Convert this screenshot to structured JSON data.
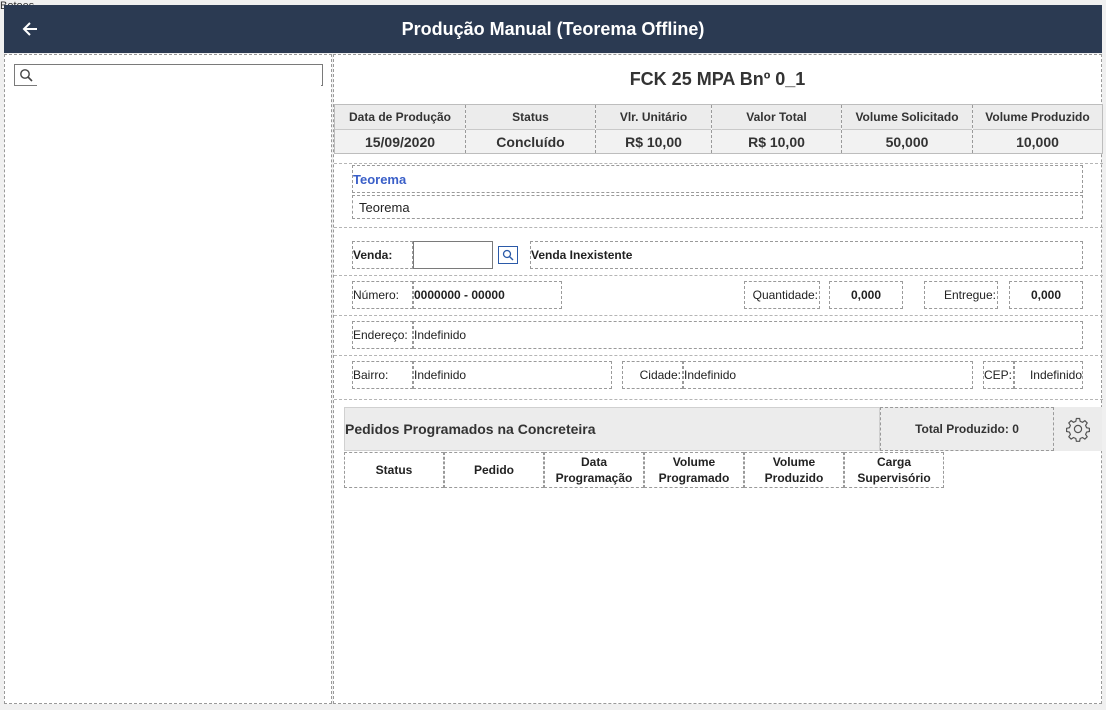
{
  "frame_label": "Botoes",
  "header": {
    "title": "Produção Manual (Teorema Offline)",
    "back_icon": "arrow-left-icon"
  },
  "sidebar": {
    "search": {
      "value": "",
      "placeholder": ""
    }
  },
  "main": {
    "product_title": "FCK 25 MPA Bnº 0_1",
    "summary": {
      "columns": [
        {
          "header": "Data de Produção",
          "value": "15/09/2020"
        },
        {
          "header": "Status",
          "value": "Concluído"
        },
        {
          "header": "Vlr. Unitário",
          "value": "R$ 10,00"
        },
        {
          "header": "Valor Total",
          "value": "R$ 10,00"
        },
        {
          "header": "Volume Solicitado",
          "value": "50,000"
        },
        {
          "header": "Volume Produzido",
          "value": "10,000"
        }
      ]
    },
    "section_title": "Teorema",
    "section_value": "Teorema",
    "venda": {
      "label": "Venda:",
      "value": "",
      "status": "Venda Inexistente"
    },
    "numero": {
      "label": "Número:",
      "value": "0000000 - 00000"
    },
    "quantidade": {
      "label": "Quantidade:",
      "value": "0,000"
    },
    "entregue": {
      "label": "Entregue:",
      "value": "0,000"
    },
    "endereco": {
      "label": "Endereço:",
      "value": "Indefinido"
    },
    "bairro": {
      "label": "Bairro:",
      "value": "Indefinido"
    },
    "cidade": {
      "label": "Cidade:",
      "value": "Indefinido"
    },
    "cep": {
      "label": "CEP:",
      "value": "Indefinido"
    },
    "pedidos": {
      "title": "Pedidos Programados na Concreteira",
      "total": "Total Produzido: 0",
      "columns": [
        "Status",
        "Pedido",
        "Data\nProgramação",
        "Volume\nProgramado",
        "Volume\nProduzido",
        "Carga\nSupervisório"
      ]
    }
  },
  "colors": {
    "titlebar": "#2b3a52",
    "link": "#3a5fc8"
  }
}
